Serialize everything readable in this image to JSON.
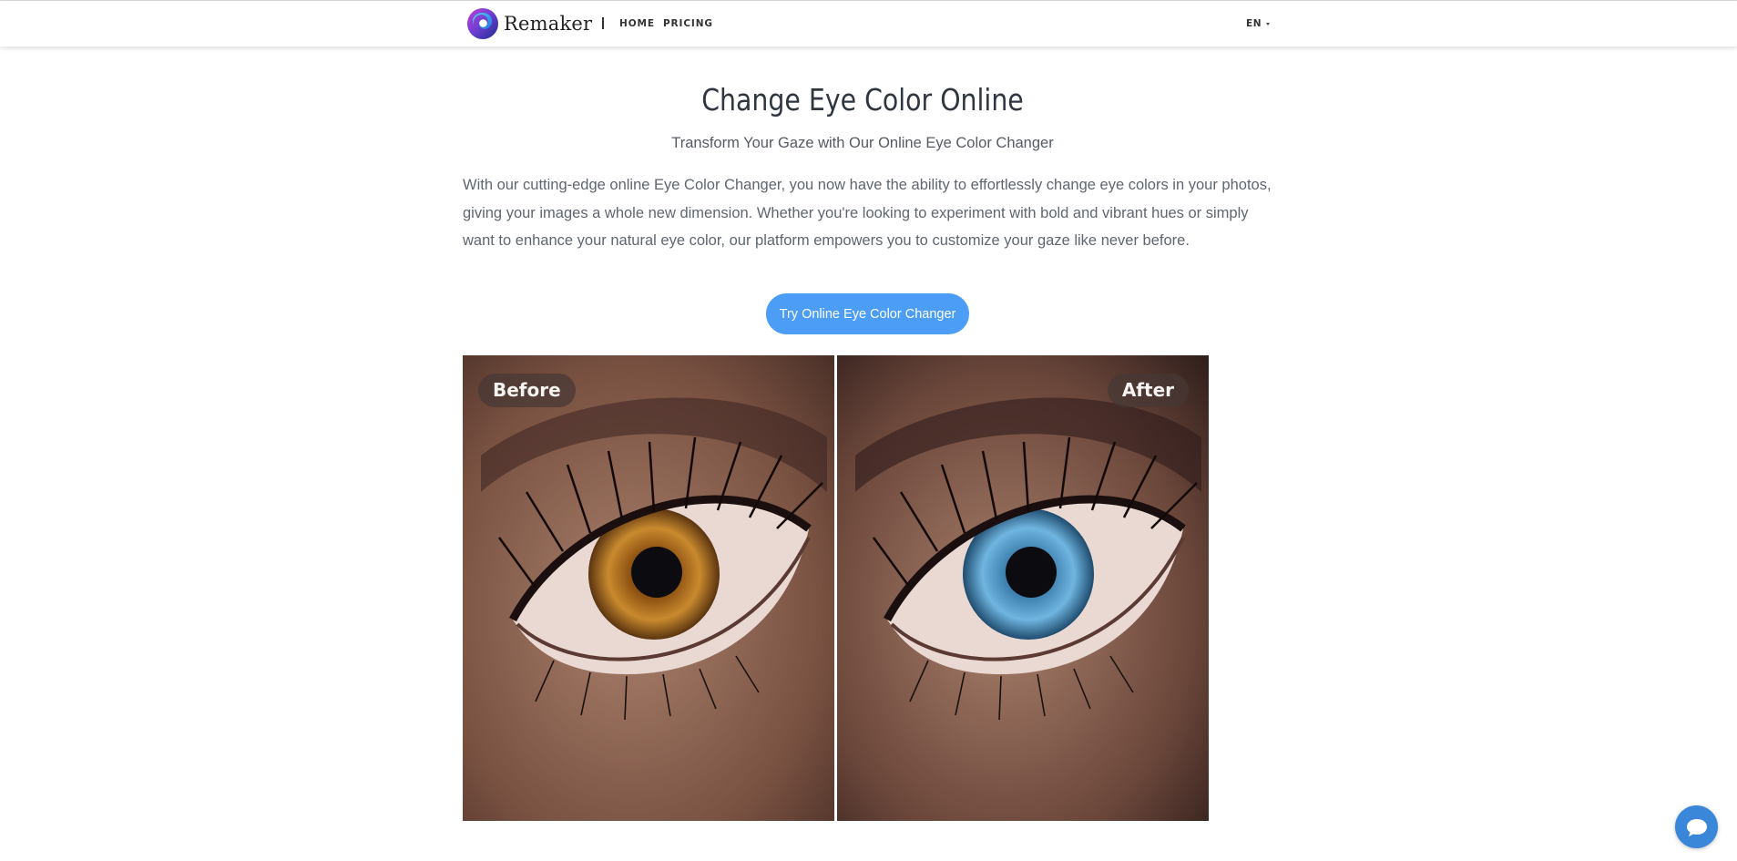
{
  "brand": {
    "name": "Remaker",
    "logo_icon": "swirl-logo-icon"
  },
  "nav": {
    "items": [
      {
        "label": "HOME"
      },
      {
        "label": "PRICING"
      }
    ]
  },
  "language": {
    "label": "EN"
  },
  "hero": {
    "title": "Change Eye Color Online",
    "subtitle": "Transform Your Gaze with Our Online Eye Color Changer",
    "description": "With our cutting-edge online Eye Color Changer, you now have the ability to effortlessly change eye colors in your photos, giving your images a whole new dimension. Whether you're looking to experiment with bold and vibrant hues or simply want to enhance your natural eye color, our platform empowers you to customize your gaze like never before.",
    "cta_label": "Try Online Eye Color Changer"
  },
  "comparison": {
    "before_label": "Before",
    "after_label": "After",
    "before_iris_color": "#c17a22",
    "after_iris_color": "#5fa8d6"
  },
  "chat": {
    "icon": "chat-bubble-icon"
  },
  "colors": {
    "accent": "#4b9df5",
    "chat": "#3a86d8"
  }
}
